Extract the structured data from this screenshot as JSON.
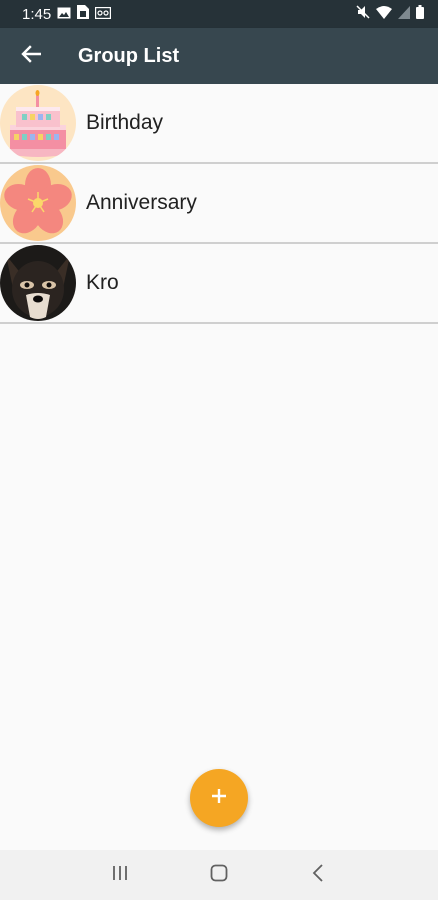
{
  "status_bar": {
    "time": "1:45",
    "icons": [
      "image-icon",
      "sim-icon",
      "voicemail-icon",
      "mute-icon",
      "wifi-icon",
      "signal-icon",
      "battery-icon"
    ]
  },
  "app_bar": {
    "title": "Group List",
    "back_icon": "arrow-back-icon"
  },
  "groups": [
    {
      "name": "Birthday",
      "avatar": "birthday-cake"
    },
    {
      "name": "Anniversary",
      "avatar": "flower"
    },
    {
      "name": "Kro",
      "avatar": "dog-photo"
    }
  ],
  "fab": {
    "icon": "plus-icon"
  },
  "nav_bar": {
    "icons": [
      "recents-icon",
      "home-icon",
      "back-icon"
    ]
  },
  "colors": {
    "status_bar": "#263238",
    "app_bar": "#37474f",
    "background": "#fafafa",
    "fab": "#f5a623"
  }
}
